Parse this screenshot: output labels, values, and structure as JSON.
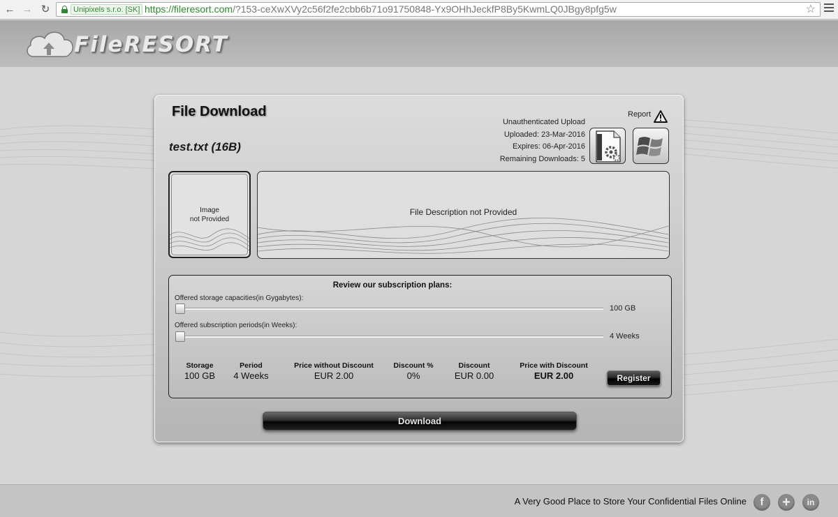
{
  "browser": {
    "ev_badge": "Unipixels s.r.o. [SK]",
    "url_scheme": "https://",
    "url_host": "fileresort.com",
    "url_path": "/?153-ceXwXVy2c56f2fe2cbb6b71o91750848-Yx9OHhJeckfP8By5KwmLQ0JBgy8pfg5w"
  },
  "brand": {
    "logo_text": "FileRESORT"
  },
  "page": {
    "title": "File Download",
    "filename": "test.txt (16B)",
    "report_label": "Report",
    "meta": {
      "upload_type": "Unauthenticated Upload",
      "uploaded": "Uploaded: 23-Mar-2016",
      "expires": "Expires: 06-Apr-2016",
      "remaining": "Remaining Downloads: 5"
    },
    "icons": {
      "file_type": "application-file-icon",
      "os": "windows-logo-icon",
      "report": "warning-triangle-icon"
    },
    "image_placeholder_line1": "Image",
    "image_placeholder_line2": "not Provided",
    "description": "File Description not Provided"
  },
  "plans": {
    "title": "Review our subscription plans:",
    "storage_label": "Offered storage capacities(in Gygabytes):",
    "storage_value": "100 GB",
    "storage_level": 0,
    "period_label": "Offered subscription periods(in Weeks):",
    "period_value": "4 Weeks",
    "period_level": 0,
    "table": {
      "headers": [
        "Storage",
        "Period",
        "Price without Discount",
        "Discount %",
        "Discount",
        "Price with Discount"
      ],
      "values": [
        "100 GB",
        "4 Weeks",
        "EUR 2.00",
        "0%",
        "EUR 0.00",
        "EUR 2.00"
      ]
    },
    "register_label": "Register"
  },
  "download_label": "Download",
  "footer": {
    "tagline": "A Very Good Place to Store Your Confidential Files Online",
    "social": [
      "facebook-icon",
      "plus-icon",
      "linkedin-icon"
    ]
  },
  "colors": {
    "url_green": "#2c8a2c",
    "button_black": "#050505",
    "page_gray": "#d6d6d6"
  }
}
